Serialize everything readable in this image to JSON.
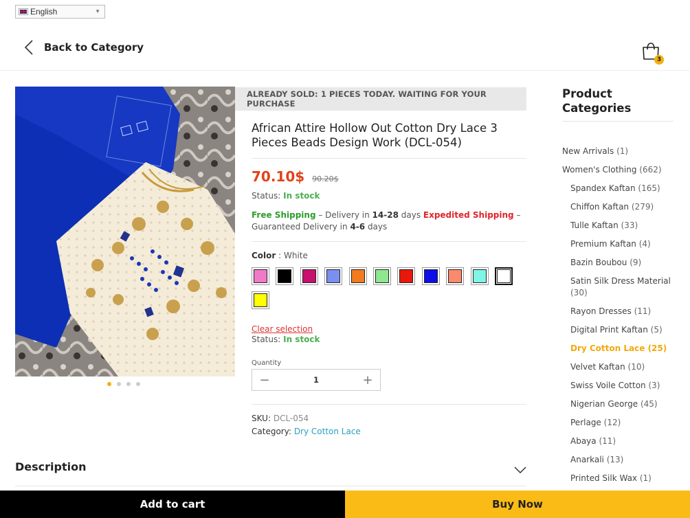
{
  "language": {
    "selected": "English"
  },
  "header": {
    "back_label": "Back to Category",
    "cart_count": "3"
  },
  "gallery": {
    "slides": 4,
    "active_slide": 1
  },
  "sold_banner": "ALREADY SOLD: 1 PIECES TODAY. WAITING FOR YOUR PURCHASE",
  "product": {
    "title": "African Attire Hollow Out Cotton Dry Lace 3 Pieces Beads Design Work (DCL-054)",
    "price": "70.10$",
    "old_price": "90.20$",
    "status_label": "Status:",
    "status_value": "In stock",
    "shipping": {
      "free": "Free Shipping",
      "dash1": " – Delivery in ",
      "days1": "14-28",
      "text1": " days ",
      "expedited": "Expedited Shipping",
      "dash2": " – Guaranteed Delivery in ",
      "days2": "4-6",
      "text2": " days"
    },
    "color_label": "Color",
    "color_value": "White",
    "colors": [
      {
        "name": "pink",
        "hex": "#f07ac8"
      },
      {
        "name": "black",
        "hex": "#000000"
      },
      {
        "name": "magenta",
        "hex": "#c8106e"
      },
      {
        "name": "periwinkle",
        "hex": "#7b8ff0"
      },
      {
        "name": "orange",
        "hex": "#f27a1f"
      },
      {
        "name": "light-green",
        "hex": "#8ee88e"
      },
      {
        "name": "red",
        "hex": "#e8180c"
      },
      {
        "name": "blue",
        "hex": "#0b0ee8"
      },
      {
        "name": "salmon",
        "hex": "#fa8a6e"
      },
      {
        "name": "aquamarine",
        "hex": "#7ef5e6"
      },
      {
        "name": "white",
        "hex": "#ffffff",
        "selected": true
      },
      {
        "name": "yellow",
        "hex": "#ffff00"
      }
    ],
    "clear_label": "Clear selection",
    "quantity_label": "Quantity",
    "quantity": "1",
    "sku_label": "SKU:",
    "sku": "DCL-054",
    "category_label": "Category:",
    "category": "Dry Cotton Lace"
  },
  "description_label": "Description",
  "sidebar": {
    "title": "Product Categories",
    "categories": [
      {
        "name": "New Arrivals",
        "count": "(1)",
        "sub": false
      },
      {
        "name": "Women's Clothing",
        "count": "(662)",
        "sub": false
      },
      {
        "name": "Spandex Kaftan",
        "count": "(165)",
        "sub": true
      },
      {
        "name": "Chiffon Kaftan",
        "count": "(279)",
        "sub": true
      },
      {
        "name": "Tulle Kaftan",
        "count": "(33)",
        "sub": true
      },
      {
        "name": "Premium Kaftan",
        "count": "(4)",
        "sub": true
      },
      {
        "name": "Bazin Boubou",
        "count": "(9)",
        "sub": true
      },
      {
        "name": "Satin Silk Dress Material",
        "count": "(30)",
        "sub": true
      },
      {
        "name": "Rayon Dresses",
        "count": "(11)",
        "sub": true
      },
      {
        "name": "Digital Print Kaftan",
        "count": "(5)",
        "sub": true
      },
      {
        "name": "Dry Cotton Lace",
        "count": "(25)",
        "sub": true,
        "active": true
      },
      {
        "name": "Velvet Kaftan",
        "count": "(10)",
        "sub": true
      },
      {
        "name": "Swiss Voile Cotton",
        "count": "(3)",
        "sub": true
      },
      {
        "name": "Nigerian George",
        "count": "(45)",
        "sub": true
      },
      {
        "name": "Perlage",
        "count": "(12)",
        "sub": true
      },
      {
        "name": "Abaya",
        "count": "(11)",
        "sub": true
      },
      {
        "name": "Anarkali",
        "count": "(13)",
        "sub": true
      },
      {
        "name": "Printed Silk Wax",
        "count": "(1)",
        "sub": true
      }
    ]
  },
  "actions": {
    "add_to_cart": "Add to cart",
    "buy_now": "Buy Now"
  }
}
